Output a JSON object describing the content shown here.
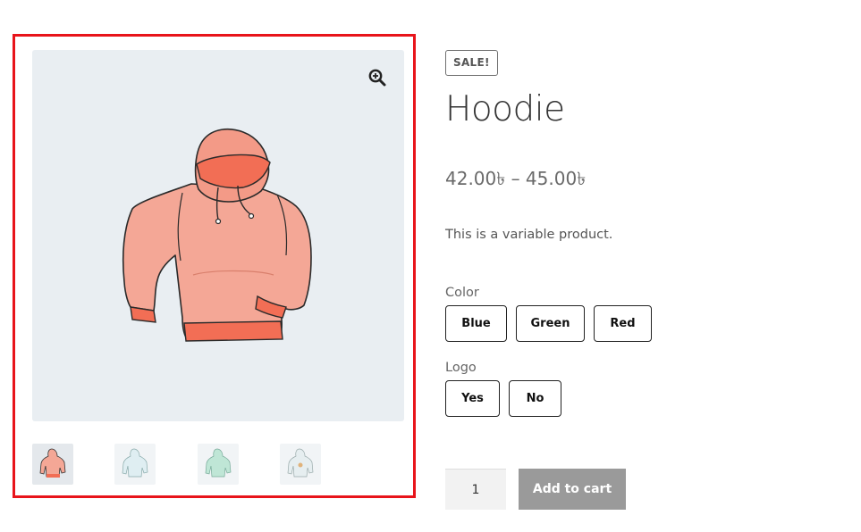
{
  "product": {
    "sale_badge": "SALE!",
    "title": "Hoodie",
    "price_range": "42.00৳ – 45.00৳",
    "short_description": "This is a variable product."
  },
  "gallery": {
    "zoom_icon": "magnifier-zoom-icon",
    "main_image": "hoodie-pink-image",
    "thumbnails": [
      "hoodie-pink",
      "hoodie-blue",
      "hoodie-green",
      "hoodie-logo"
    ]
  },
  "attributes": {
    "color": {
      "label": "Color",
      "options": [
        "Blue",
        "Green",
        "Red"
      ]
    },
    "logo": {
      "label": "Logo",
      "options": [
        "Yes",
        "No"
      ]
    }
  },
  "cart": {
    "quantity": "1",
    "add_to_cart_label": "Add to cart"
  },
  "colors": {
    "highlight_border": "#e8141b",
    "image_bg": "#e9eef2",
    "button_bg": "#9a9a9a"
  }
}
